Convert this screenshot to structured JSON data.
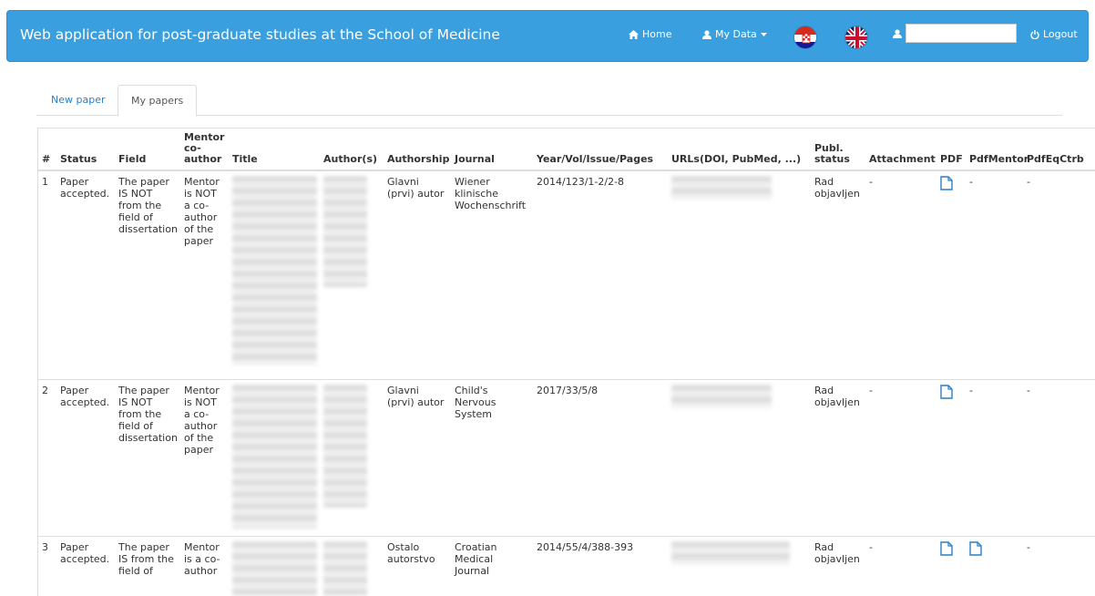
{
  "navbar": {
    "title": "Web application for post-graduate studies at the School of Medicine",
    "home_label": "Home",
    "mydata_label": "My Data",
    "logout_label": "Logout",
    "user_value": ""
  },
  "tabs": {
    "new_paper": "New paper",
    "my_papers": "My papers"
  },
  "table": {
    "headers": {
      "num": "#",
      "status": "Status",
      "field": "Field",
      "mentor": "Mentor co-author",
      "title": "Title",
      "authors": "Author(s)",
      "authorship": "Authorship",
      "journal": "Journal",
      "yvip": "Year/Vol/Issue/Pages",
      "urls": "URLs(DOI, PubMed, ...)",
      "publ": "Publ. status",
      "attachment": "Attachment",
      "pdf": "PDF",
      "pdfmentor": "PdfMentor",
      "pdfeq": "PdfEqCtrb"
    },
    "rows": [
      {
        "num": "1",
        "status": "Paper accepted.",
        "field": "The paper IS NOT from the field of dissertation",
        "mentor": "Mentor is NOT a co-author of the paper",
        "authorship": "Glavni (prvi) autor",
        "journal": "Wiener klinische Wochenschrift",
        "yvip": "2014/123/1-2/2-8",
        "publ": "Rad objavljen",
        "attachment": "-",
        "pdfmentor": "-",
        "pdfeq": "-"
      },
      {
        "num": "2",
        "status": "Paper accepted.",
        "field": "The paper IS NOT from the field of dissertation",
        "mentor": "Mentor is NOT a co-author of the paper",
        "authorship": "Glavni (prvi) autor",
        "journal": "Child's Nervous System",
        "yvip": "2017/33/5/8",
        "publ": "Rad objavljen",
        "attachment": "-",
        "pdfmentor": "-",
        "pdfeq": "-"
      },
      {
        "num": "3",
        "status": "Paper accepted.",
        "field": "The paper IS from the field of",
        "mentor": "Mentor is a co-author",
        "authorship": "Ostalo autorstvo",
        "journal": "Croatian Medical Journal",
        "yvip": "2014/55/4/388-393",
        "publ": "Rad objavljen",
        "attachment": "-",
        "pdfeq": "-"
      }
    ]
  },
  "colors": {
    "navbar": "#3a9fde",
    "link": "#2a7fc7",
    "pdf_icon": "#2a7fc7"
  }
}
